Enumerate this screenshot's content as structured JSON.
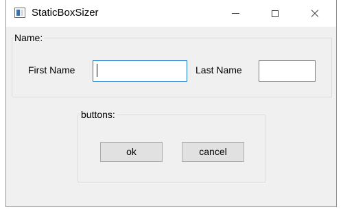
{
  "window": {
    "title": "StaticBoxSizer",
    "icon": "window-app-icon"
  },
  "name_group": {
    "label": "Name:",
    "first_name_label": "First Name",
    "first_name_value": "",
    "last_name_label": "Last Name",
    "last_name_value": ""
  },
  "buttons_group": {
    "label": "buttons:",
    "ok_label": "ok",
    "cancel_label": "cancel"
  },
  "colors": {
    "focus_border": "#1a6fc4",
    "window_bg": "#f0f0f0",
    "titlebar_bg": "#ffffff",
    "button_bg": "#e1e1e1"
  }
}
